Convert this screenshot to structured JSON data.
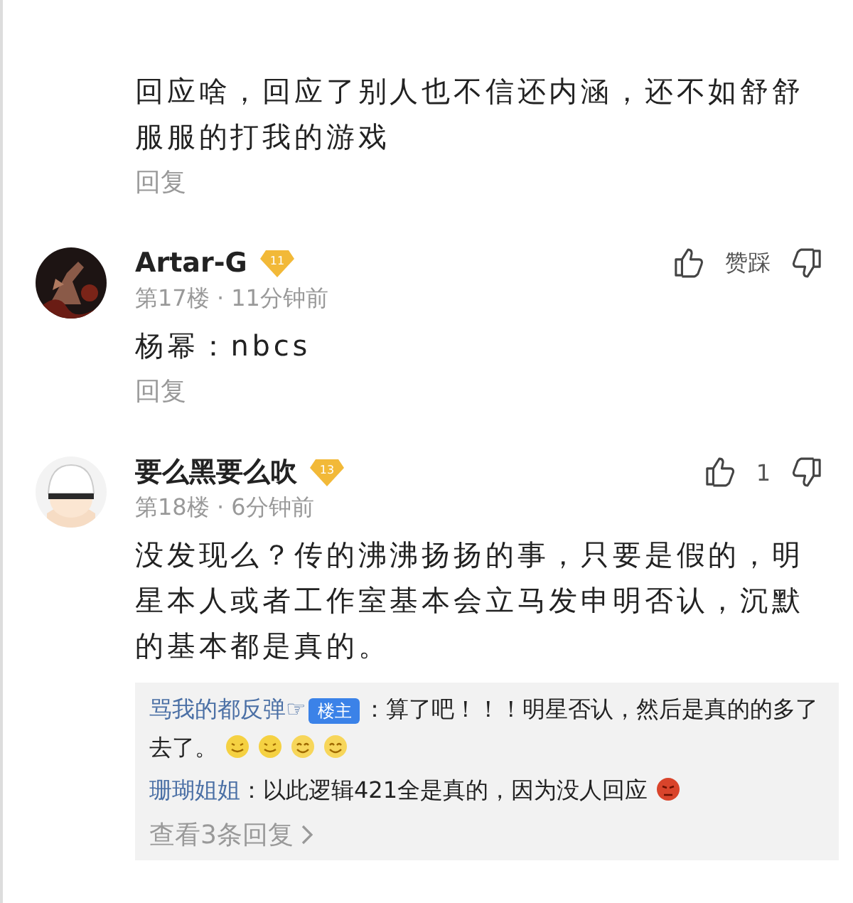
{
  "comments": [
    {
      "body": "回应啥，回应了别人也不信还内涵，还不如舒舒服服的打我的游戏",
      "reply_label": "回复"
    },
    {
      "avatar": {
        "kind": "picture"
      },
      "name": "Artar-G",
      "level": "11",
      "meta": "第17楼 · 11分钟前",
      "votes": "赞踩",
      "body": "杨幂：nbcs",
      "reply_label": "回复"
    },
    {
      "avatar": {
        "kind": "picture"
      },
      "name": "要么黑要么吹",
      "level": "13",
      "meta": "第18楼 · 6分钟前",
      "votes": "1",
      "body": "没发现么？传的沸沸扬扬的事，只要是假的，明星本人或者工作室基本会立马发申明否认，沉默的基本都是真的。",
      "replies": [
        {
          "author": "骂我的都反弹☞",
          "op_badge": "楼主",
          "text": "：算了吧！！！明星否认，然后是真的的多了去了。",
          "emojis": [
            {
              "kind": "smirk"
            },
            {
              "kind": "smirk"
            },
            {
              "kind": "smile"
            },
            {
              "kind": "smile"
            }
          ]
        },
        {
          "author": "珊瑚姐姐",
          "text": "：以此逻辑421全是真的，因为没人回应",
          "emojis": [
            {
              "kind": "angry"
            }
          ]
        }
      ],
      "more_replies": "查看3条回复"
    }
  ]
}
